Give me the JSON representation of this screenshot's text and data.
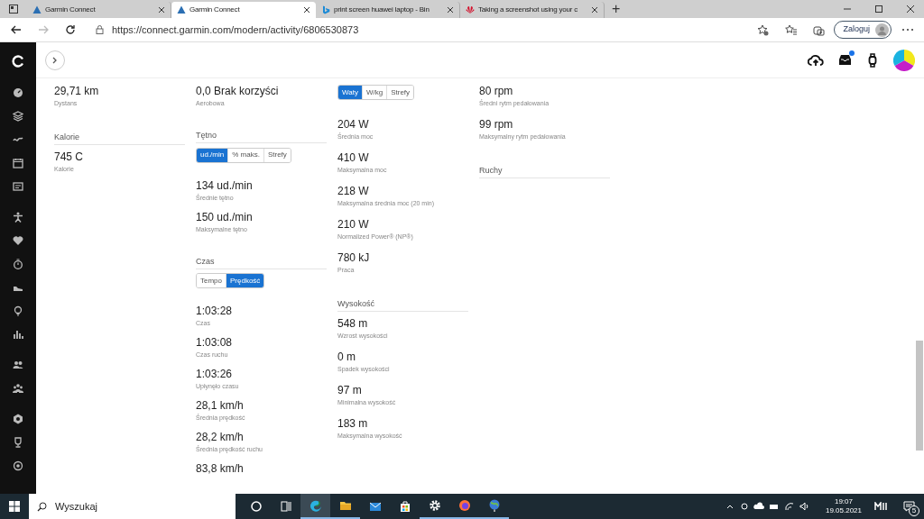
{
  "browser": {
    "tabs": [
      {
        "title": "Garmin Connect",
        "selected": false,
        "kind": "garmin"
      },
      {
        "title": "Garmin Connect",
        "selected": true,
        "kind": "garmin"
      },
      {
        "title": "print screen huawei laptop - Bin",
        "selected": false,
        "kind": "bing"
      },
      {
        "title": "Taking a screenshot using your c",
        "selected": false,
        "kind": "huawei"
      }
    ],
    "new_tab": "+",
    "url": "https://connect.garmin.com/modern/activity/6806530873",
    "sign_in": "Zaloguj"
  },
  "header": {
    "notification_dot": true
  },
  "columns": [
    [
      {
        "kind": "stat",
        "value": "29,71 km",
        "label": "Dystans"
      },
      {
        "kind": "heading",
        "title": "Kalorie"
      },
      {
        "kind": "stat",
        "value": "745 C",
        "label": "Kalorie"
      }
    ],
    [
      {
        "kind": "stat",
        "value": "0,0 Brak korzyści",
        "label": "Aerobowa"
      },
      {
        "kind": "heading",
        "title": "Tętno"
      },
      {
        "kind": "toggle",
        "options": [
          {
            "label": "ud./min",
            "selected": true
          },
          {
            "label": "% maks.",
            "selected": false
          },
          {
            "label": "Strefy",
            "selected": false
          }
        ]
      },
      {
        "kind": "stat",
        "value": "134 ud./min",
        "label": "Średnie tętno"
      },
      {
        "kind": "stat",
        "value": "150 ud./min",
        "label": "Maksymalne tętno"
      },
      {
        "kind": "heading",
        "title": "Czas"
      },
      {
        "kind": "toggle",
        "options": [
          {
            "label": "Tempo",
            "selected": false
          },
          {
            "label": "Prędkość",
            "selected": true
          }
        ]
      },
      {
        "kind": "stat",
        "value": "1:03:28",
        "label": "Czas"
      },
      {
        "kind": "stat",
        "value": "1:03:08",
        "label": "Czas ruchu"
      },
      {
        "kind": "stat",
        "value": "1:03:26",
        "label": "Upłynęło czasu"
      },
      {
        "kind": "stat",
        "value": "28,1 km/h",
        "label": "Średnia prędkość"
      },
      {
        "kind": "stat",
        "value": "28,2 km/h",
        "label": "Średnia prędkość ruchu"
      },
      {
        "kind": "stat",
        "value": "83,8 km/h"
      }
    ],
    [
      {
        "kind": "toggle",
        "options": [
          {
            "label": "Waty",
            "selected": true
          },
          {
            "label": "W/kg",
            "selected": false
          },
          {
            "label": "Strefy",
            "selected": false
          }
        ]
      },
      {
        "kind": "stat",
        "value": "204 W",
        "label": "Średnia moc"
      },
      {
        "kind": "stat",
        "value": "410 W",
        "label": "Maksymalna moc"
      },
      {
        "kind": "stat",
        "value": "218 W",
        "label": "Maksymalna średnia moc (20 min)"
      },
      {
        "kind": "stat",
        "value": "210 W",
        "label": "Normalized Power® (NP®)"
      },
      {
        "kind": "stat",
        "value": "780 kJ",
        "label": "Praca"
      },
      {
        "kind": "heading",
        "title": "Wysokość"
      },
      {
        "kind": "stat",
        "value": "548 m",
        "label": "Wzrost wysokości"
      },
      {
        "kind": "stat",
        "value": "0 m",
        "label": "Spadek wysokości"
      },
      {
        "kind": "stat",
        "value": "97 m",
        "label": "Minimalna wysokość"
      },
      {
        "kind": "stat",
        "value": "183 m",
        "label": "Maksymalna wysokość"
      }
    ],
    [
      {
        "kind": "stat",
        "value": "80 rpm",
        "label": "Średni rytm pedałowania"
      },
      {
        "kind": "stat",
        "value": "99 rpm",
        "label": "Maksymalny rytm pedałowania"
      },
      {
        "kind": "heading",
        "title": "Ruchy"
      }
    ]
  ],
  "taskbar": {
    "search_placeholder": "Wyszukaj",
    "time": "19:07",
    "date": "19.05.2021",
    "notifications": "5"
  }
}
